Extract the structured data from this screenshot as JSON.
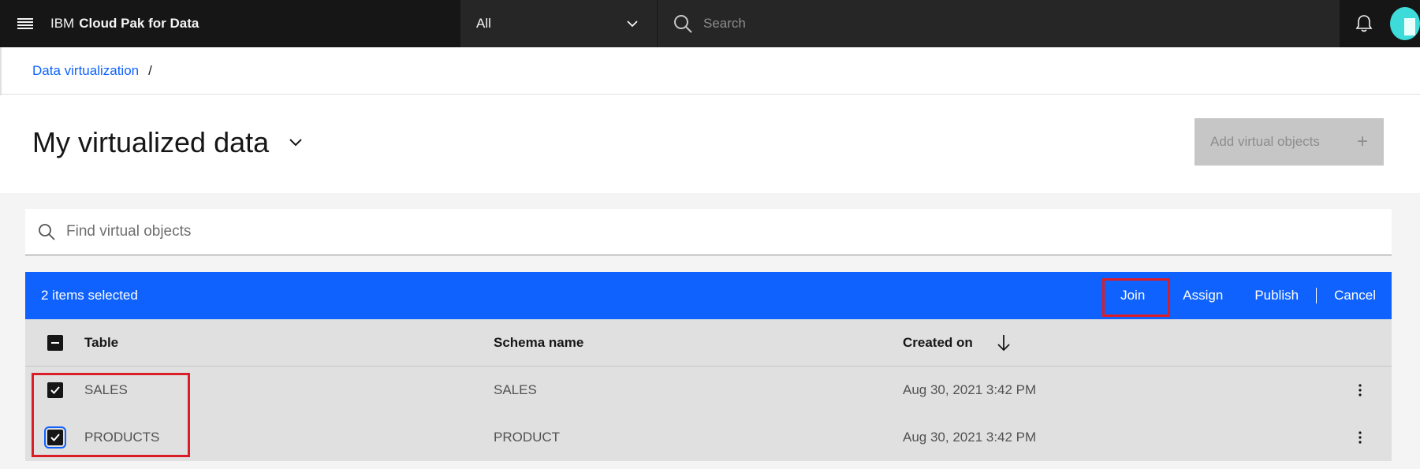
{
  "header": {
    "brand_prefix": "IBM",
    "brand_name": "Cloud Pak for Data",
    "scope_value": "All",
    "search_placeholder": "Search"
  },
  "breadcrumb": {
    "link": "Data virtualization",
    "separator": "/"
  },
  "page": {
    "title": "My virtualized data",
    "add_button_label": "Add virtual objects"
  },
  "find": {
    "placeholder": "Find virtual objects"
  },
  "batch": {
    "count_label": "2 items selected",
    "actions": [
      "Join",
      "Assign",
      "Publish",
      "Cancel"
    ]
  },
  "table": {
    "columns": [
      "Table",
      "Schema name",
      "Created on"
    ],
    "rows": [
      {
        "table": "SALES",
        "schema": "SALES",
        "created": "Aug 30, 2021 3:42 PM",
        "checked": true
      },
      {
        "table": "PRODUCTS",
        "schema": "PRODUCT",
        "created": "Aug 30, 2021 3:42 PM",
        "checked": true
      }
    ]
  },
  "colors": {
    "header_bg": "#161616",
    "accent": "#0f62fe",
    "highlight": "#da1e28",
    "table_bg": "#e0e0e0"
  }
}
